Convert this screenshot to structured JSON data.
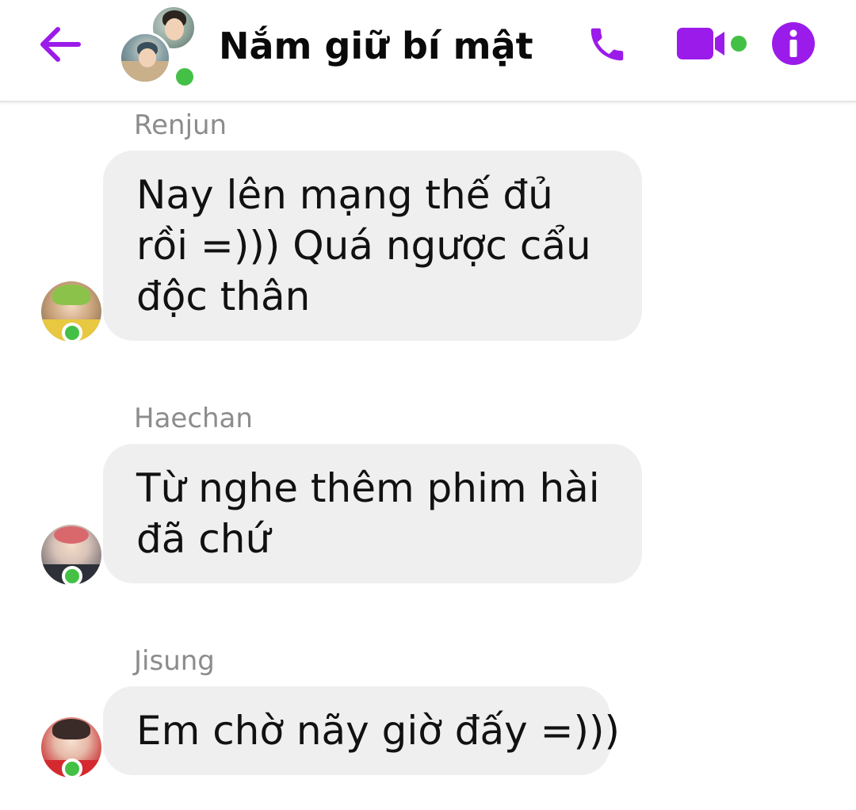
{
  "header": {
    "title": "Nắm giữ bí mật",
    "accent_color": "#9b1bea",
    "online_color": "#44c046",
    "icons": {
      "back": "back-arrow-icon",
      "call": "phone-icon",
      "video": "video-camera-icon",
      "info": "info-icon"
    }
  },
  "messages": [
    {
      "sender": "Renjun",
      "text": "Nay lên mạng thế đủ rồi =))) Quá ngược cẩu độc thân",
      "online": true
    },
    {
      "sender": "Haechan",
      "text": "Từ nghe thêm phim hài đã chứ",
      "online": true
    },
    {
      "sender": "Jisung",
      "text": "Em chờ nãy giờ đấy =)))",
      "online": true
    }
  ]
}
